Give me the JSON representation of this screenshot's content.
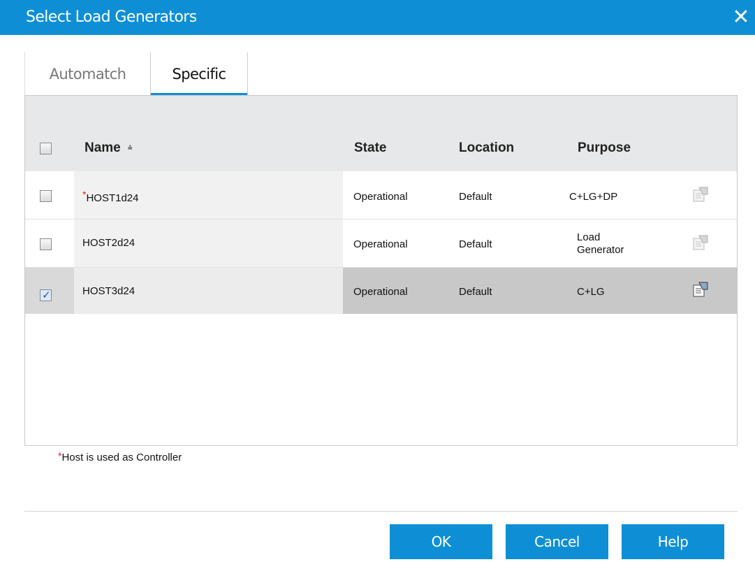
{
  "dialog": {
    "title": "Select Load Generators",
    "close_glyph": "✕"
  },
  "tabs": [
    {
      "label": "Automatch",
      "active": false
    },
    {
      "label": "Specific",
      "active": true
    }
  ],
  "table": {
    "columns": {
      "name": "Name",
      "state": "State",
      "location": "Location",
      "purpose": "Purpose"
    },
    "sort": {
      "column": "Name",
      "glyph": "⩮",
      "direction": "ascending"
    },
    "rows": [
      {
        "required_marker": "*",
        "name": "HOST1d24",
        "state": "Operational",
        "location": "Default",
        "purpose": "C+LG+DP",
        "checked": false
      },
      {
        "required_marker": "",
        "name": "HOST2d24",
        "state": "Operational",
        "location": "Default",
        "purpose_line1": "Load",
        "purpose_line2": "Generator",
        "checked": false
      },
      {
        "required_marker": "",
        "name": "HOST3d24",
        "state": "Operational",
        "location": "Default",
        "purpose": "C+LG",
        "checked": true
      }
    ]
  },
  "footnote": {
    "marker": "*",
    "text": "Host is used as Controller"
  },
  "buttons": {
    "ok": "OK",
    "cancel": "Cancel",
    "help": "Help"
  },
  "colors": {
    "accent": "#0e8fd5",
    "required": "#e0212a",
    "selected_row": "#c8c8c8"
  },
  "icons": {
    "row_action": "properties-icon",
    "check": "✓"
  }
}
